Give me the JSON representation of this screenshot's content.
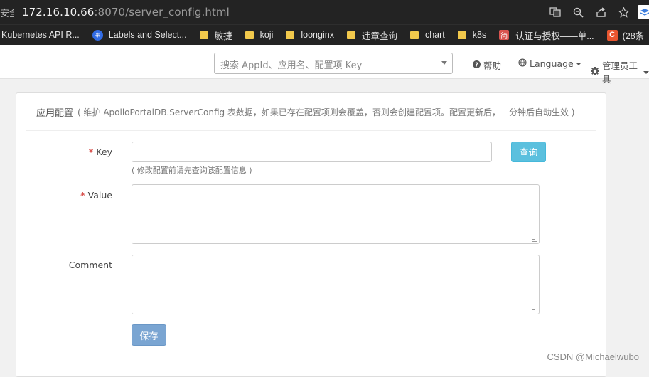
{
  "browser": {
    "security_label": "安全",
    "url_host": "172.16.10.66",
    "url_path": ":8070/server_config.html",
    "bookmarks": [
      {
        "label": "Kubernetes API R...",
        "icon": "none"
      },
      {
        "label": "Labels and Select...",
        "icon": "kubernetes-icon"
      },
      {
        "label": "敏捷",
        "icon": "folder-icon"
      },
      {
        "label": "koji",
        "icon": "folder-icon"
      },
      {
        "label": "loonginx",
        "icon": "folder-icon"
      },
      {
        "label": "违章查询",
        "icon": "folder-icon"
      },
      {
        "label": "chart",
        "icon": "folder-icon"
      },
      {
        "label": "k8s",
        "icon": "folder-icon"
      },
      {
        "label": "认证与授权——单...",
        "icon": "jianshu-icon",
        "icon_text": "简"
      },
      {
        "label": "(28条",
        "icon": "csdn-icon",
        "icon_text": "C"
      }
    ]
  },
  "navbar": {
    "search_placeholder": "搜索 AppId、应用名、配置项 Key",
    "help_label": "帮助",
    "language_label": "Language",
    "admin_tools_label": "管理员工具"
  },
  "panel": {
    "title": "应用配置",
    "subtitle": "( 维护 ApolloPortalDB.ServerConfig 表数据，如果已存在配置项则会覆盖，否则会创建配置项。配置更新后，一分钟后自动生效 )",
    "key_label": "Key",
    "key_hint": "( 修改配置前请先查询该配置信息 )",
    "query_button": "查询",
    "value_label": "Value",
    "comment_label": "Comment",
    "save_button": "保存",
    "required_mark": "*"
  },
  "watermark": "CSDN @Michaelwubo",
  "colors": {
    "query_button": "#5bc0de",
    "save_button": "#7aa5d2",
    "required": "#d9534f"
  }
}
